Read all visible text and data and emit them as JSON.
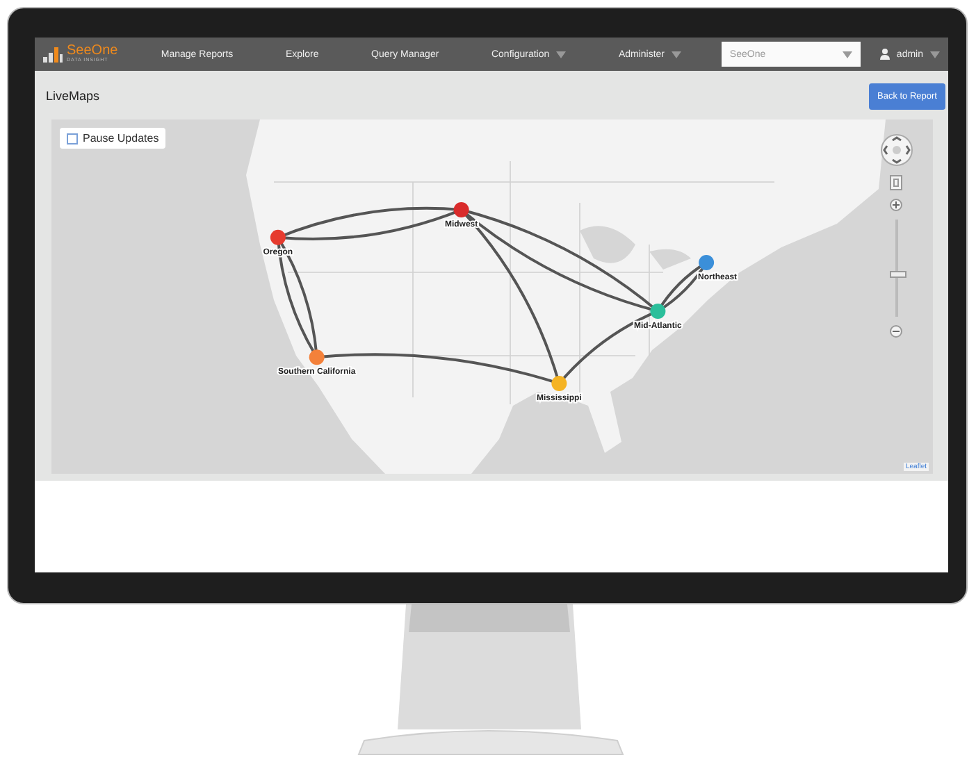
{
  "navbar": {
    "brand": {
      "name": "SeeOne",
      "tagline": "DATA INSIGHT"
    },
    "items": [
      {
        "label": "Manage Reports",
        "dropdown": false
      },
      {
        "label": "Explore",
        "dropdown": false
      },
      {
        "label": "Query Manager",
        "dropdown": false
      },
      {
        "label": "Configuration",
        "dropdown": true
      },
      {
        "label": "Administer",
        "dropdown": true
      }
    ],
    "selector": {
      "value": "SeeOne"
    },
    "user": {
      "name": "admin"
    }
  },
  "page": {
    "title": "LiveMaps",
    "back_button": "Back to Report"
  },
  "map": {
    "pause_updates": {
      "label": "Pause Updates",
      "checked": false
    },
    "nodes": [
      {
        "label": "Oregon",
        "color": "#e63b2e"
      },
      {
        "label": "Midwest",
        "color": "#d92b2b"
      },
      {
        "label": "Southern California",
        "color": "#f4813a"
      },
      {
        "label": "Mississippi",
        "color": "#f5b323"
      },
      {
        "label": "Mid-Atlantic",
        "color": "#2bbf9b"
      },
      {
        "label": "Northeast",
        "color": "#3b8fd9"
      }
    ],
    "zoom": {
      "level": 0.45
    },
    "attribution": "Leaflet"
  }
}
